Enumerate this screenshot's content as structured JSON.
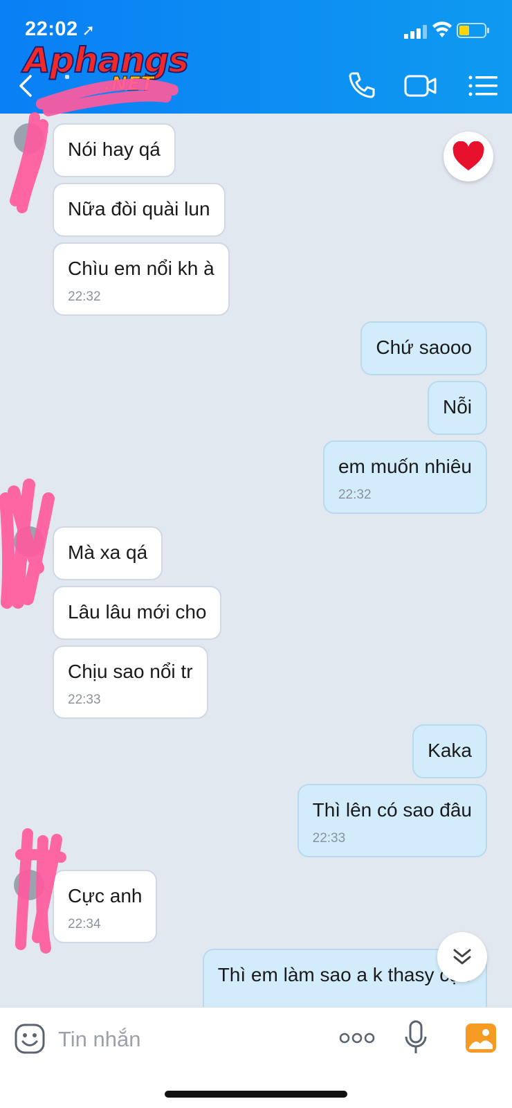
{
  "status_bar": {
    "time": "22:02"
  },
  "watermark": {
    "brand": "Aphangs",
    "domain": ".NET"
  },
  "header": {
    "icons": [
      "back-icon",
      "phone-icon",
      "video-icon",
      "menu-icon"
    ]
  },
  "messages": [
    {
      "side": "in",
      "text": "Nói hay qá"
    },
    {
      "side": "in",
      "text": "Nữa đòi quài lun"
    },
    {
      "side": "in",
      "text": "Chìu em nổi kh à",
      "time": "22:32"
    },
    {
      "side": "out",
      "text": "Chứ saooo"
    },
    {
      "side": "out",
      "text": "Nỗi"
    },
    {
      "side": "out",
      "text": "em muốn nhiêu",
      "time": "22:32"
    },
    {
      "side": "in",
      "text": "Mà xa qá"
    },
    {
      "side": "in",
      "text": "Lâu lâu mới cho"
    },
    {
      "side": "in",
      "text": "Chịu sao nổi tr",
      "time": "22:33"
    },
    {
      "side": "out",
      "text": "Kaka"
    },
    {
      "side": "out",
      "text": "Thì lên có sao đâu",
      "time": "22:33"
    },
    {
      "side": "in",
      "text": "Cực anh",
      "time": "22:34"
    },
    {
      "side": "out",
      "text": "Thì em làm sao a k thasy cực"
    }
  ],
  "reaction": {
    "icon": "heart-icon"
  },
  "composer": {
    "placeholder": "Tin nhắn"
  },
  "colors": {
    "header": "#0a7ff5",
    "outgoing": "#d2ecfb",
    "incoming": "#ffffff",
    "background": "#e2e8f0",
    "scribble": "#ff5a9c"
  }
}
